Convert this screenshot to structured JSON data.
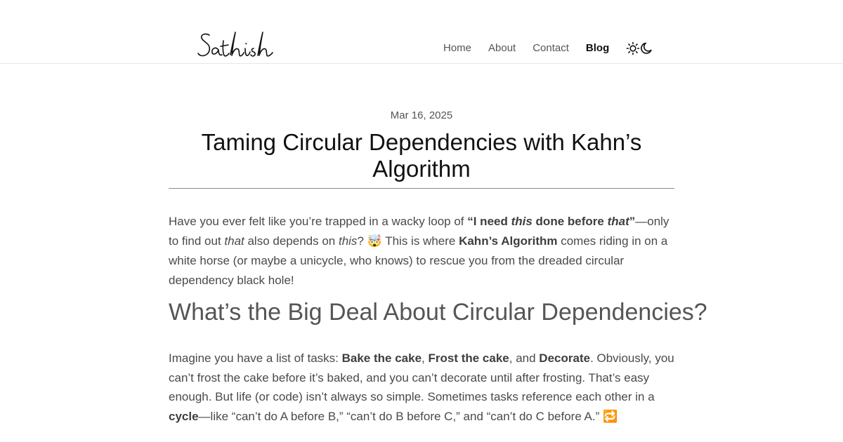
{
  "header": {
    "logo_text": "Sathish",
    "nav": [
      {
        "label": "Home",
        "active": false
      },
      {
        "label": "About",
        "active": false
      },
      {
        "label": "Contact",
        "active": false
      },
      {
        "label": "Blog",
        "active": true
      }
    ],
    "icons": [
      "sun-icon",
      "moon-icon"
    ]
  },
  "post": {
    "date": "Mar 16, 2025",
    "title": "Taming Circular Dependencies with Kahn’s Algorithm",
    "intro": {
      "t1": "Have you ever felt like you’re trapped in a wacky loop of ",
      "b1a": "“I need ",
      "b1i": "this",
      "b1b": " done before ",
      "b1i2": "that",
      "b1c": "”",
      "t2": "—only to find out ",
      "i1": "that",
      "t3": " also depends on ",
      "i2": "this",
      "t4": "? ",
      "emoji": "🤯",
      "t5": " This is where ",
      "b2": "Kahn’s Algorithm",
      "t6": " comes riding in on a white horse (or maybe a unicycle, who knows) to rescue you from the dreaded circular dependency black hole!"
    },
    "section_heading": "What’s the Big Deal About Circular Dependencies?",
    "para2": {
      "t1": "Imagine you have a list of tasks: ",
      "b1": "Bake the cake",
      "t2": ", ",
      "b2": "Frost the cake",
      "t3": ", and ",
      "b3": "Decorate",
      "t4": ". Obviously, you can’t frost the cake before it’s baked, and you can’t decorate until after frosting. That’s easy enough. But life (or code) isn’t always so simple. Sometimes tasks reference each other in a ",
      "b4": "cycle",
      "t5": "—like “can’t do A before B,” “can’t do B before C,” and “can’t do C before A.” ",
      "emoji": "🔁"
    }
  },
  "colors": {
    "text": "#4a4a4a",
    "heading": "#111111",
    "rule": "#8a8a8a",
    "background": "#ffffff"
  }
}
